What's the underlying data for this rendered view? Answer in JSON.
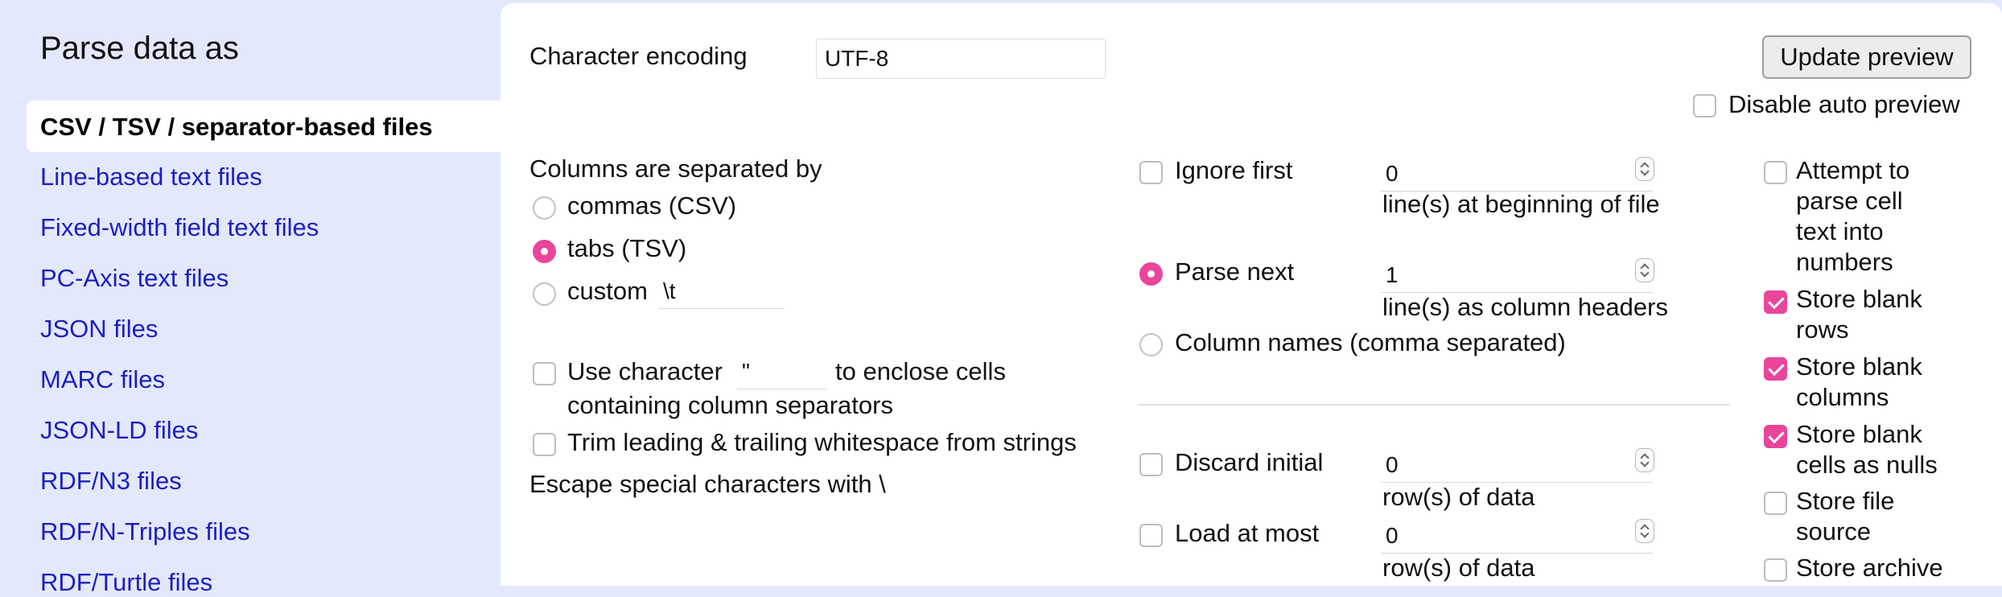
{
  "sidebar": {
    "title": "Parse data as",
    "active_item": "CSV / TSV / separator-based files",
    "items": [
      "Line-based text files",
      "Fixed-width field text files",
      "PC-Axis text files",
      "JSON files",
      "MARC files",
      "JSON-LD files",
      "RDF/N3 files",
      "RDF/N-Triples files",
      "RDF/Turtle files"
    ]
  },
  "encoding": {
    "label": "Character encoding",
    "value": "UTF-8"
  },
  "preview": {
    "update_button": "Update preview",
    "disable_auto_label": "Disable auto preview",
    "disable_auto_checked": false
  },
  "separator": {
    "heading": "Columns are separated by",
    "option_comma": "commas (CSV)",
    "option_tab": "tabs (TSV)",
    "option_custom": "custom",
    "custom_value": "\\t",
    "selected": "tabs (TSV)"
  },
  "quote": {
    "label_before": "Use character",
    "char_value": "\"",
    "label_after": "to enclose cells",
    "label_line2": "containing column separators",
    "checked": false
  },
  "trim": {
    "label": "Trim leading & trailing whitespace from strings",
    "checked": false
  },
  "escape": {
    "label": "Escape special characters with \\"
  },
  "ignore_first": {
    "label": "Ignore first",
    "value": "0",
    "suffix": "line(s) at beginning of file",
    "checked": false
  },
  "parse_next": {
    "label": "Parse next",
    "value": "1",
    "suffix": "line(s) as column headers",
    "selected": true
  },
  "column_names": {
    "label": "Column names (comma separated)",
    "value": "",
    "selected": false
  },
  "discard_initial": {
    "label": "Discard initial",
    "value": "0",
    "suffix": "row(s) of data",
    "checked": false
  },
  "load_at_most": {
    "label": "Load at most",
    "value": "0",
    "suffix": "row(s) of data",
    "checked": false
  },
  "options": {
    "parse_numbers": {
      "line1": "Attempt to",
      "line2": "parse cell",
      "line3": "text into",
      "line4": "numbers",
      "checked": false
    },
    "blank_rows": {
      "line1": "Store blank",
      "line2": "rows",
      "checked": true
    },
    "blank_columns": {
      "line1": "Store blank",
      "line2": "columns",
      "checked": true
    },
    "blank_cells": {
      "line1": "Store blank",
      "line2": "cells as nulls",
      "checked": true
    },
    "file_source": {
      "line1": "Store file",
      "line2": "source",
      "checked": false
    },
    "archive": {
      "line1": "Store archive",
      "checked": false
    }
  },
  "colors": {
    "accent": "#e8459b",
    "link": "#1b1fc4",
    "sidebar_bg": "#e4e8fc"
  }
}
